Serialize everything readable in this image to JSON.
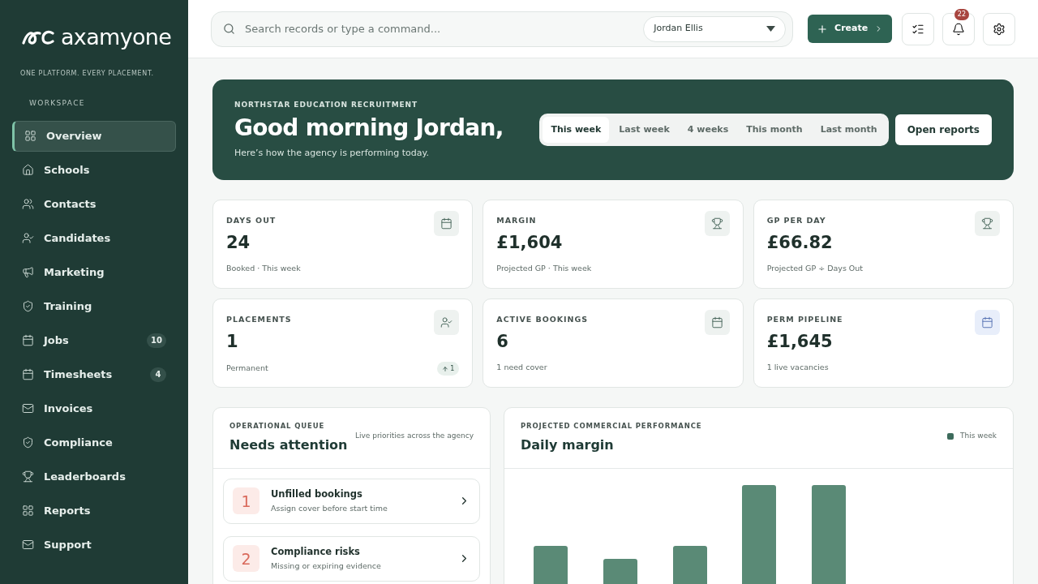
{
  "brand": {
    "name": "axamyone",
    "tagline": "ONE PLATFORM. EVERY PLACEMENT."
  },
  "sidebar": {
    "section": "WORKSPACE",
    "items": [
      {
        "label": "Overview",
        "selected": true
      },
      {
        "label": "Schools",
        "selected": false
      },
      {
        "label": "Contacts",
        "selected": false
      },
      {
        "label": "Candidates",
        "selected": false
      },
      {
        "label": "Marketing",
        "selected": false
      },
      {
        "label": "Training",
        "selected": false
      },
      {
        "label": "Jobs",
        "selected": false,
        "badge": "10"
      },
      {
        "label": "Timesheets",
        "selected": false,
        "badge": "4"
      },
      {
        "label": "Invoices",
        "selected": false
      },
      {
        "label": "Compliance",
        "selected": false
      },
      {
        "label": "Leaderboards",
        "selected": false
      },
      {
        "label": "Reports",
        "selected": false
      },
      {
        "label": "Support",
        "selected": false
      }
    ]
  },
  "topbar": {
    "search": {
      "placeholder": "Search records or type a command..."
    },
    "user_select": "Jordan Ellis",
    "create_button": "Create",
    "notifications": "22"
  },
  "hero": {
    "eyebrow": "NORTHSTAR EDUCATION RECRUITMENT",
    "title": "Good morning Jordan,",
    "subtitle": "Here’s how the agency is performing today.",
    "periods": [
      {
        "label": "This week",
        "selected": true
      },
      {
        "label": "Last week",
        "selected": false
      },
      {
        "label": "4 weeks",
        "selected": false
      },
      {
        "label": "This month",
        "selected": false
      },
      {
        "label": "Last month",
        "selected": false
      }
    ],
    "action": "Open reports"
  },
  "stats": [
    {
      "label": "DAYS OUT",
      "value": "24",
      "note": "Booked · This week"
    },
    {
      "label": "MARGIN",
      "value": "£1,604",
      "note": "Projected GP · This week"
    },
    {
      "label": "GP PER DAY",
      "value": "£66.82",
      "note": "Projected GP ÷ Days Out"
    },
    {
      "label": "PLACEMENTS",
      "value": "1",
      "note": "Permanent",
      "trend": "1"
    },
    {
      "label": "ACTIVE BOOKINGS",
      "value": "6",
      "note": "1 need cover"
    },
    {
      "label": "PERM PIPELINE",
      "value": "£1,645",
      "note": "1 live vacancies"
    }
  ],
  "queue": {
    "eyebrow": "OPERATIONAL QUEUE",
    "title": "Needs attention",
    "caption": "Live priorities across the agency",
    "items": [
      {
        "number": "1",
        "title": "Unfilled bookings",
        "subtitle": "Assign cover before start time"
      },
      {
        "number": "2",
        "title": "Compliance risks",
        "subtitle": "Missing or expiring evidence"
      }
    ]
  },
  "performance": {
    "eyebrow": "PROJECTED COMMERCIAL PERFORMANCE",
    "title": "Daily margin",
    "legend": {
      "label": "This week",
      "color": "#3d6b5c"
    }
  }
}
